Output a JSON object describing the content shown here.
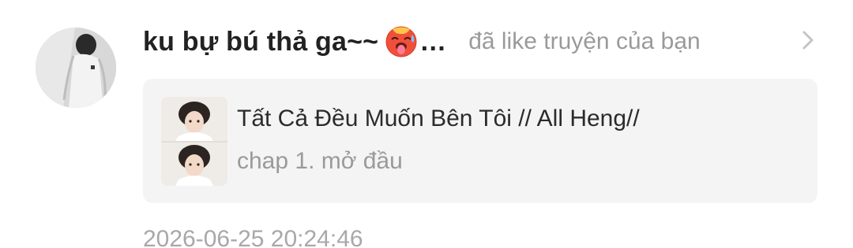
{
  "notification": {
    "username": "ku bự bú thả ga~~",
    "username_emoji": "hot-face-emoji",
    "ellipsis": "…",
    "action": "đã like truyện của bạn",
    "story": {
      "title": "Tất Cả Đều Muốn Bên Tôi // All Heng//",
      "chapter": "chap 1. mở đầu"
    },
    "timestamp": "2026-06-25 20:24:46"
  },
  "colors": {
    "username": "#222222",
    "secondary_text": "#9a9a9a",
    "card_background": "#f4f4f5",
    "chevron": "#c4c4c4"
  },
  "icons": {
    "avatar": "user-avatar-photo",
    "emoji": "hot-face-emoji",
    "chevron": "chevron-right-icon",
    "cover": "story-cover-thumbnail"
  }
}
